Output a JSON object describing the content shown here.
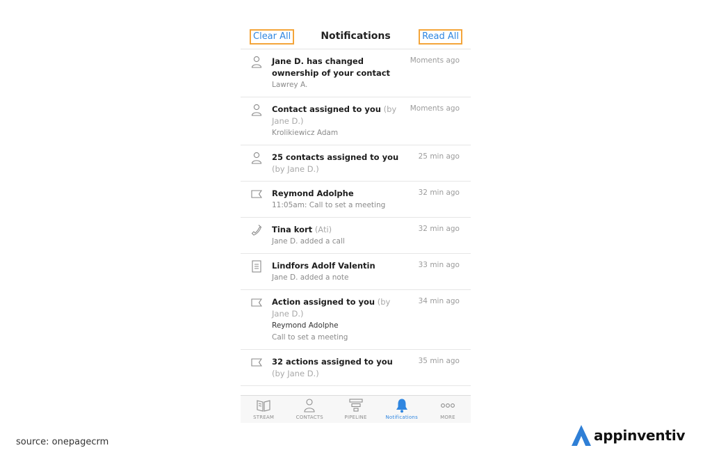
{
  "navbar": {
    "clear_all": "Clear All",
    "title": "Notifications",
    "read_all": "Read All"
  },
  "notifications": [
    {
      "icon": "person-icon",
      "title": "Jane D. has changed ownership of your contact",
      "by": "",
      "line1": "Lawrey A.",
      "line2": "",
      "time": "Moments ago"
    },
    {
      "icon": "person-icon",
      "title": "Contact assigned to you",
      "by": "(by Jane D.)",
      "line1": "Krolikiewicz Adam",
      "line2": "",
      "time": "Moments ago"
    },
    {
      "icon": "person-icon",
      "title": "25 contacts assigned to you",
      "by": "(by Jane D.)",
      "line1": "",
      "line2": "",
      "time": "25 min ago"
    },
    {
      "icon": "flag-icon",
      "title": "Reymond Adolphe",
      "by": "",
      "line1": "11:05am: Call to set a meeting",
      "line2": "",
      "time": "32 min ago"
    },
    {
      "icon": "phone-icon",
      "title": "Tina kort",
      "by": "(Ati)",
      "line1": "Jane D. added a call",
      "line2": "",
      "time": "32 min ago"
    },
    {
      "icon": "note-icon",
      "title": "Lindfors Adolf Valentin",
      "by": "",
      "line1": "Jane D. added a note",
      "line2": "",
      "time": "33 min ago"
    },
    {
      "icon": "flag-icon",
      "title": "Action assigned to you",
      "by": "(by Jane D.)",
      "line1": "Reymond Adolphe",
      "line2": "Call to set a meeting",
      "time": "34 min ago"
    },
    {
      "icon": "flag-icon",
      "title": "32 actions assigned to you",
      "by": "(by Jane D.)",
      "line1": "",
      "line2": "",
      "time": "35 min ago"
    }
  ],
  "tabs": [
    {
      "label": "STREAM",
      "icon": "stream-icon",
      "active": false
    },
    {
      "label": "CONTACTS",
      "icon": "contacts-icon",
      "active": false
    },
    {
      "label": "PIPELINE",
      "icon": "pipeline-icon",
      "active": false
    },
    {
      "label": "Notifications",
      "icon": "bell-icon",
      "active": true
    },
    {
      "label": "MORE",
      "icon": "more-icon",
      "active": false
    }
  ],
  "footer": {
    "source": "source: onepagecrm",
    "brand": "appinventiv"
  },
  "colors": {
    "accent": "#2f86e0",
    "highlight_border": "#f4a53a",
    "brand_blue": "#2f7fd6"
  }
}
